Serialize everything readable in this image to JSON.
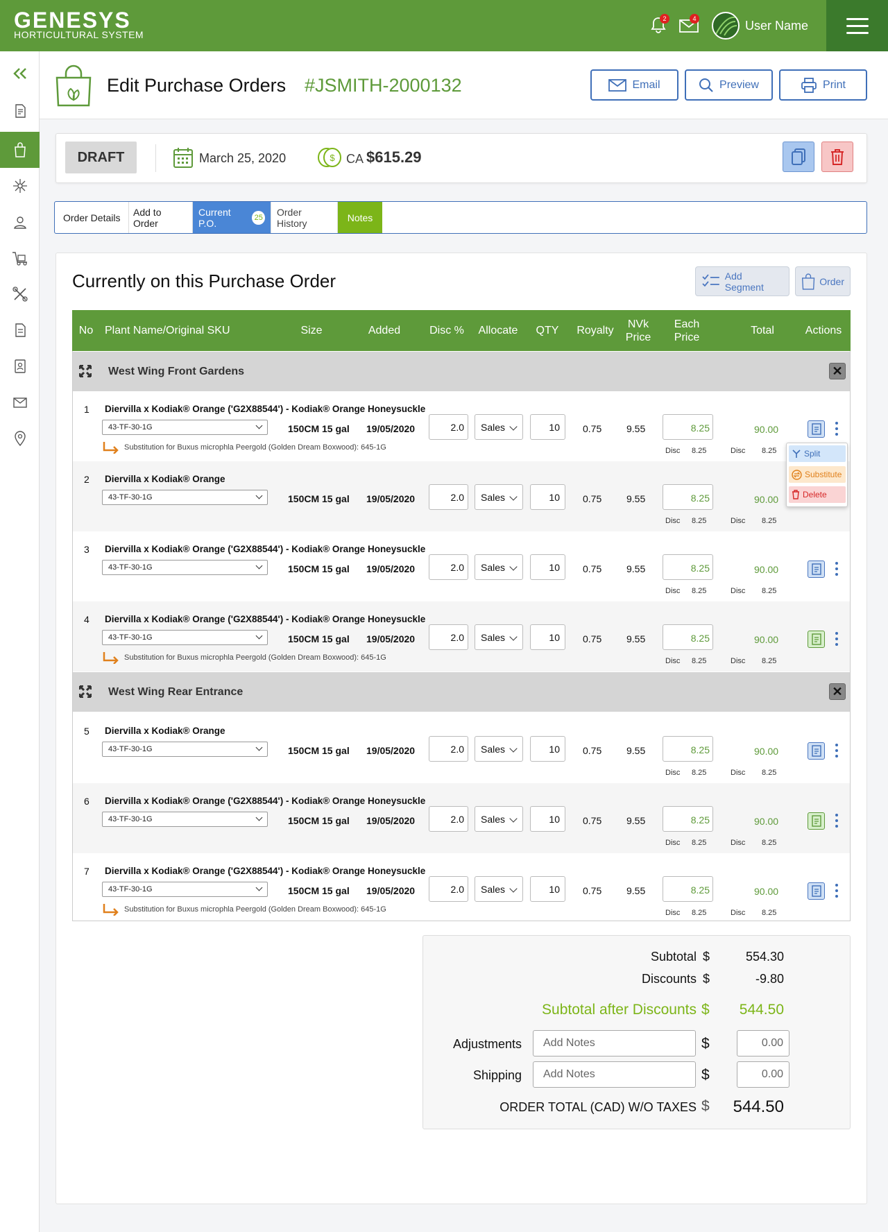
{
  "app": {
    "logo_main": "GENESYS",
    "logo_sub": "HORTICULTURAL SYSTEM",
    "notifications_count": "2",
    "messages_count": "4",
    "user_name": "User Name"
  },
  "header": {
    "title": "Edit Purchase Orders",
    "po_number": "#JSMITH-2000132",
    "email_label": "Email",
    "preview_label": "Preview",
    "print_label": "Print"
  },
  "status": {
    "state": "DRAFT",
    "date": "March 25, 2020",
    "currency": "CA",
    "amount": "$615.29"
  },
  "tabs": [
    {
      "label": "Order Details"
    },
    {
      "label": "Add to Order"
    },
    {
      "label": "Current P.O.",
      "count": "25"
    },
    {
      "label": "Order History"
    },
    {
      "label": "Notes"
    }
  ],
  "section": {
    "title": "Currently on this Purchase Order",
    "add_segment_label": "Add Segment",
    "order_label": "Order"
  },
  "columns": {
    "no": "No",
    "plant": "Plant Name/Original SKU",
    "size": "Size",
    "added": "Added",
    "disc": "Disc %",
    "allocate": "Allocate",
    "qty": "QTY",
    "royalty": "Royalty",
    "nvk1": "NVk",
    "nvk2": "Price",
    "each1": "Each",
    "each2": "Price",
    "total": "Total",
    "actions": "Actions"
  },
  "segments": [
    {
      "title": "West Wing Front Gardens"
    },
    {
      "title": "West Wing Rear Entrance"
    }
  ],
  "rows": [
    {
      "no": "1",
      "name": "Diervilla x Kodiak® Orange ('G2X88544') - Kodiak® Orange Honeysuckle",
      "sku": "43-TF-30-1G",
      "size": "150CM 15 gal",
      "added": "19/05/2020",
      "disc": "2.0",
      "allocate": "Sales",
      "qty": "10",
      "royalty": "0.75",
      "nvk": "9.55",
      "each": "8.25",
      "total": "90.00",
      "disc_label": "Disc",
      "disc_each": "8.25",
      "disc_total": "8.25",
      "substitution": "Substitution for Buxus microphla Peergold (Golden Dream Boxwood): 645-1G"
    },
    {
      "no": "2",
      "name": "Diervilla x Kodiak® Orange",
      "sku": "43-TF-30-1G",
      "size": "150CM 15 gal",
      "added": "19/05/2020",
      "disc": "2.0",
      "allocate": "Sales",
      "qty": "10",
      "royalty": "0.75",
      "nvk": "9.55",
      "each": "8.25",
      "total": "90.00",
      "disc_label": "Disc",
      "disc_each": "8.25",
      "disc_total": "8.25"
    },
    {
      "no": "3",
      "name": "Diervilla x Kodiak® Orange ('G2X88544') - Kodiak® Orange Honeysuckle",
      "sku": "43-TF-30-1G",
      "size": "150CM 15 gal",
      "added": "19/05/2020",
      "disc": "2.0",
      "allocate": "Sales",
      "qty": "10",
      "royalty": "0.75",
      "nvk": "9.55",
      "each": "8.25",
      "total": "90.00",
      "disc_label": "Disc",
      "disc_each": "8.25",
      "disc_total": "8.25"
    },
    {
      "no": "4",
      "name": "Diervilla x Kodiak® Orange ('G2X88544') - Kodiak® Orange Honeysuckle",
      "sku": "43-TF-30-1G",
      "size": "150CM 15 gal",
      "added": "19/05/2020",
      "disc": "2.0",
      "allocate": "Sales",
      "qty": "10",
      "royalty": "0.75",
      "nvk": "9.55",
      "each": "8.25",
      "total": "90.00",
      "disc_label": "Disc",
      "disc_each": "8.25",
      "disc_total": "8.25",
      "substitution": "Substitution for Buxus microphla Peergold (Golden Dream Boxwood): 645-1G"
    },
    {
      "no": "5",
      "name": "Diervilla x Kodiak® Orange",
      "sku": "43-TF-30-1G",
      "size": "150CM 15 gal",
      "added": "19/05/2020",
      "disc": "2.0",
      "allocate": "Sales",
      "qty": "10",
      "royalty": "0.75",
      "nvk": "9.55",
      "each": "8.25",
      "total": "90.00",
      "disc_label": "Disc",
      "disc_each": "8.25",
      "disc_total": "8.25"
    },
    {
      "no": "6",
      "name": "Diervilla x Kodiak® Orange ('G2X88544') - Kodiak® Orange Honeysuckle",
      "sku": "43-TF-30-1G",
      "size": "150CM 15 gal",
      "added": "19/05/2020",
      "disc": "2.0",
      "allocate": "Sales",
      "qty": "10",
      "royalty": "0.75",
      "nvk": "9.55",
      "each": "8.25",
      "total": "90.00",
      "disc_label": "Disc",
      "disc_each": "8.25",
      "disc_total": "8.25"
    },
    {
      "no": "7",
      "name": "Diervilla x Kodiak® Orange ('G2X88544') - Kodiak® Orange Honeysuckle",
      "sku": "43-TF-30-1G",
      "size": "150CM 15 gal",
      "added": "19/05/2020",
      "disc": "2.0",
      "allocate": "Sales",
      "qty": "10",
      "royalty": "0.75",
      "nvk": "9.55",
      "each": "8.25",
      "total": "90.00",
      "disc_label": "Disc",
      "disc_each": "8.25",
      "disc_total": "8.25",
      "substitution": "Substitution for Buxus microphla Peergold (Golden Dream Boxwood): 645-1G"
    }
  ],
  "row_menu": {
    "split": "Split",
    "substitute": "Substitute",
    "delete": "Delete"
  },
  "totals": {
    "subtotal_label": "Subtotal",
    "subtotal": "554.30",
    "discounts_label": "Discounts",
    "discounts": "-9.80",
    "after_label": "Subtotal after Discounts",
    "after": "544.50",
    "adjustments_label": "Adjustments",
    "shipping_label": "Shipping",
    "notes_placeholder": "Add Notes",
    "zero": "0.00",
    "order_total_label": "ORDER TOTAL (CAD) W/O TAXES",
    "order_total": "544.50",
    "currency_symbol": "$"
  },
  "colors": {
    "brand_green": "#5e9a3a",
    "accent_blue": "#3f6fb8",
    "lime_green": "#7cb518"
  }
}
